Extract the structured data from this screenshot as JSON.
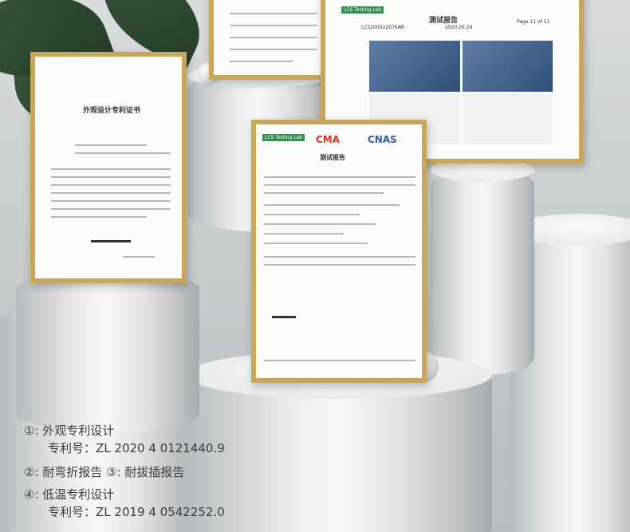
{
  "certificates": {
    "patent_design_title": "外观设计专利证书",
    "lcs_logo": "LCS Testing Lab",
    "report_title": "测试报告",
    "report_no": "LCS200522076AR",
    "report_date": "2020.05.29",
    "report_page": "Page 11 of 11",
    "cma_mark": "CMA",
    "cnas_mark": "CNAS"
  },
  "captions": {
    "line1": "①: 外观专利设计",
    "line2": "专利号：ZL 2020 4 0121440.9",
    "line3": "②: 耐弯折报告   ③: 耐拔插报告",
    "line4": "④: 低温专利设计",
    "line5": "专利号：ZL 2019 4 0542252.0"
  }
}
